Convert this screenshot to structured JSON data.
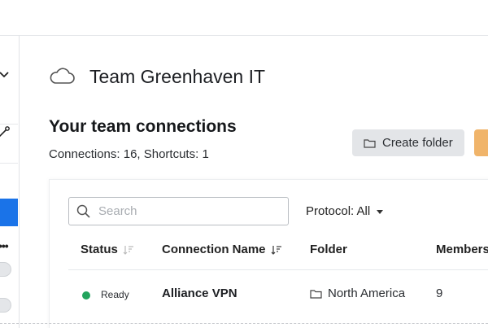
{
  "team": {
    "name": "Team Greenhaven IT"
  },
  "section": {
    "title": "Your team connections",
    "counts": "Connections: 16, Shortcuts: 1"
  },
  "actions": {
    "create_folder_label": "Create folder"
  },
  "filters": {
    "search_placeholder": "Search",
    "protocol_label": "Protocol: All"
  },
  "table": {
    "columns": [
      "Status",
      "Connection Name",
      "Folder",
      "Members"
    ],
    "rows": [
      {
        "status": "Ready",
        "name": "Alliance VPN",
        "folder": "North America",
        "members": "9"
      }
    ]
  },
  "colors": {
    "accent": "#1a73e8",
    "status_ready": "#22a45d",
    "secondary_button": "#e3e5e8",
    "primary_button": "#f0b46a"
  },
  "icons": {
    "header": "cloud-icon",
    "search": "search-icon",
    "folder": "folder-icon",
    "sort": "sort-icon"
  }
}
